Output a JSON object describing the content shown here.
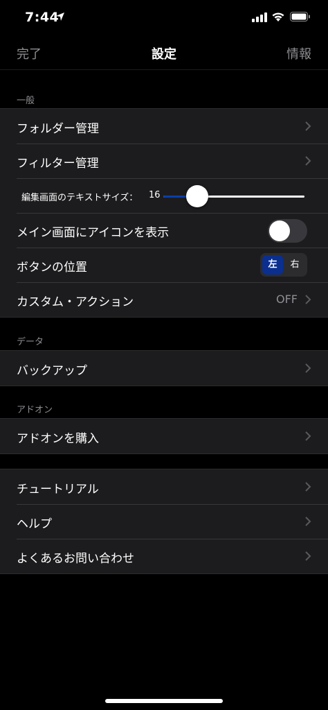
{
  "status_bar": {
    "time": "7:44"
  },
  "nav": {
    "left": "完了",
    "title": "設定",
    "right": "情報"
  },
  "sections": {
    "general": "一般",
    "data": "データ",
    "addon": "アドオン"
  },
  "general": {
    "folder_manage": "フォルダー管理",
    "filter_manage": "フィルター管理",
    "text_size_label": "編集画面のテキストサイズ：",
    "text_size_value": "16",
    "text_size_level": 0.22,
    "show_icon": "メイン画面にアイコンを表示",
    "show_icon_on": false,
    "button_position": "ボタンの位置",
    "button_position_options": [
      "左",
      "右"
    ],
    "button_position_selected": "左",
    "custom_action": "カスタム・アクション",
    "custom_action_value": "OFF"
  },
  "data": {
    "backup": "バックアップ"
  },
  "addon": {
    "purchase": "アドオンを購入"
  },
  "misc": {
    "tutorial": "チュートリアル",
    "help": "ヘルプ",
    "faq": "よくあるお問い合わせ"
  },
  "colors": {
    "accent": "#0a3fa8",
    "segment_selected": "#0a2f8f",
    "cell_bg": "#1c1c1e"
  }
}
